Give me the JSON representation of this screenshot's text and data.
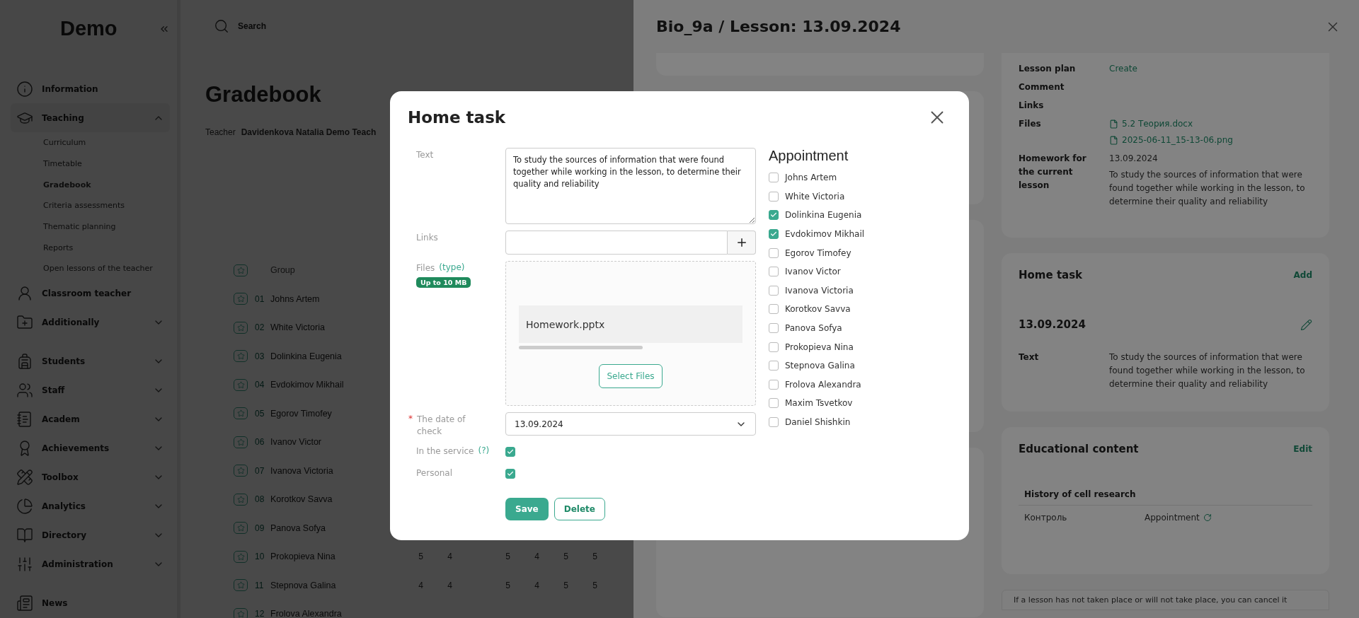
{
  "sidebar": {
    "logo": "Demo",
    "sections": [
      [
        {
          "label": "Information"
        },
        {
          "label": "Teaching",
          "expanded": true,
          "children": [
            {
              "label": "Curriculum",
              "selected": false
            },
            {
              "label": "Timetable",
              "selected": false
            },
            {
              "label": "Gradebook",
              "selected": true
            },
            {
              "label": "Criteria assessments",
              "selected": false
            },
            {
              "label": "Thematic planning",
              "selected": false
            },
            {
              "label": "Reports",
              "selected": false
            },
            {
              "label": "Open lessons of the teacher",
              "selected": false
            }
          ]
        },
        {
          "label": "Classroom teacher"
        },
        {
          "label": "Additionally",
          "expanded": false
        }
      ],
      [
        {
          "label": "Students",
          "expanded": false
        },
        {
          "label": "Staff",
          "expanded": false
        },
        {
          "label": "Academ",
          "expanded": false
        },
        {
          "label": "Achievements",
          "expanded": false
        },
        {
          "label": "Toolbox",
          "expanded": false
        },
        {
          "label": "Analytics",
          "expanded": false
        },
        {
          "label": "Directory",
          "expanded": false
        },
        {
          "label": "Administration",
          "expanded": false
        }
      ],
      [
        {
          "label": "News"
        }
      ]
    ]
  },
  "search": {
    "placeholder": "Search"
  },
  "gradebook": {
    "title": "Gradebook",
    "teacher_label": "Teacher",
    "teacher_name": "Davidenkova Natalia Demo Teach",
    "group_header": "Group",
    "students": [
      {
        "number": "01",
        "name": "Johns Artem"
      },
      {
        "number": "02",
        "name": "White Victoria"
      },
      {
        "number": "03",
        "name": "Dolinkina Eugenia"
      },
      {
        "number": "04",
        "name": "Evdokimov Mikhail"
      },
      {
        "number": "05",
        "name": "Egorov Timofey"
      },
      {
        "number": "06",
        "name": "Ivanov Victor"
      },
      {
        "number": "07",
        "name": "Ivanova Victoria"
      },
      {
        "number": "08",
        "name": "Korotkov Savva"
      },
      {
        "number": "09",
        "name": "Panova Sofya"
      },
      {
        "number": "10",
        "name": "Prokopieva Nina",
        "grades": [
          "5",
          "4",
          "5",
          "4",
          "5",
          "5"
        ]
      },
      {
        "number": "11",
        "name": "Stepnova Galina",
        "grades": [
          "4",
          "4",
          "5",
          "4",
          "5",
          "5"
        ]
      },
      {
        "number": "12",
        "name": "Frolova Alexandra"
      }
    ]
  },
  "drawer": {
    "title": "Bio_9a / Lesson: 13.09.2024",
    "info": [
      {
        "label": "Lesson plan",
        "links": [
          "Create"
        ]
      },
      {
        "label": "Comment"
      },
      {
        "label": "Links"
      },
      {
        "label": "Files",
        "files": [
          "5.2 Теория.docx",
          "2025-06-11_15-13-06.png"
        ]
      },
      {
        "label": "Homework for the current lesson",
        "date": "13.09.2024",
        "text": "To study the sources of information that were found together while working in the lesson, to determine their quality and reliability"
      }
    ],
    "home_task": {
      "title": "Home task",
      "action": "Add",
      "date": "13.09.2024",
      "text_label": "Text",
      "text": "To study the sources of information that were found together while working in the lesson, to determine their quality and reliability"
    },
    "educational_content": {
      "title": "Educational content",
      "action": "Edit",
      "table_title": "History of cell research",
      "rows": [
        {
          "name": "Контроль",
          "status": "Appointment"
        }
      ]
    },
    "notice": "If a lesson has not taken place or will not take place, you can cancel it"
  },
  "modal": {
    "title": "Home task",
    "text_label": "Text",
    "text": "To study the sources of information that were found together while working in the lesson, to determine their quality and reliability",
    "links_label": "Links",
    "files_label": "Files",
    "files_type_link": "(type)",
    "files_limit": "Up to 10 MB",
    "files": [
      "Homework.pptx"
    ],
    "select_files": "Select Files",
    "date_label": "The date of check",
    "required_mark": "*",
    "date": "13.09.2024",
    "in_service_label": "In the service",
    "in_service_help": "(?)",
    "in_service": true,
    "personal_label": "Personal",
    "personal": true,
    "save": "Save",
    "delete": "Delete",
    "appointment": {
      "title": "Appointment",
      "students": [
        {
          "name": "Johns Artem",
          "checked": false
        },
        {
          "name": "White Victoria",
          "checked": false
        },
        {
          "name": "Dolinkina Eugenia",
          "checked": true
        },
        {
          "name": "Evdokimov Mikhail",
          "checked": true
        },
        {
          "name": "Egorov Timofey",
          "checked": false
        },
        {
          "name": "Ivanov Victor",
          "checked": false
        },
        {
          "name": "Ivanova Victoria",
          "checked": false
        },
        {
          "name": "Korotkov Savva",
          "checked": false
        },
        {
          "name": "Panova Sofya",
          "checked": false
        },
        {
          "name": "Prokopieva Nina",
          "checked": false
        },
        {
          "name": "Stepnova Galina",
          "checked": false
        },
        {
          "name": "Frolova Alexandra",
          "checked": false
        },
        {
          "name": "Maxim Tsvetkov",
          "checked": false
        },
        {
          "name": "Daniel Shishkin",
          "checked": false
        }
      ]
    }
  }
}
